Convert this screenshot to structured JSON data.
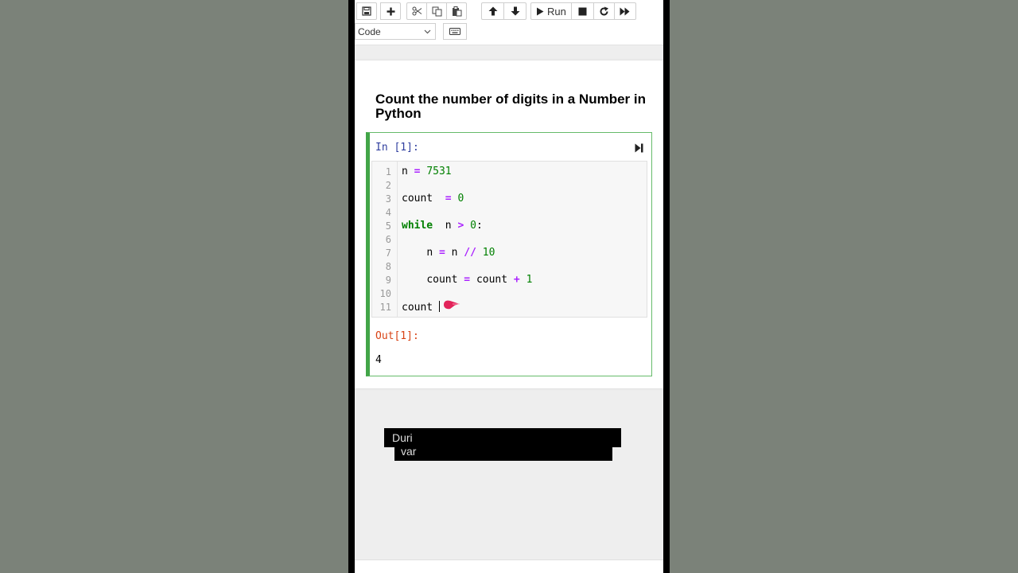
{
  "toolbar": {
    "buttons": [
      {
        "icon": "save-icon"
      },
      {
        "icon": "plus-icon"
      },
      {
        "icon": "cut-icon"
      },
      {
        "icon": "copy-icon"
      },
      {
        "icon": "paste-icon"
      },
      {
        "icon": "arrow-up-icon"
      },
      {
        "icon": "arrow-down-icon"
      },
      {
        "icon": "run-icon"
      },
      {
        "icon": "stop-icon"
      },
      {
        "icon": "restart-icon"
      },
      {
        "icon": "fast-forward-icon"
      }
    ],
    "run_label": "Run",
    "cell_type": "Code",
    "keyboard_icon": "keyboard-icon"
  },
  "notebook": {
    "title": "Count the number of digits in a Number in Python",
    "cell": {
      "in_prompt": "In [1]:",
      "out_prompt": "Out[1]:",
      "output": "4",
      "line_numbers": [
        "1",
        "2",
        "3",
        "4",
        "5",
        "6",
        "7",
        "8",
        "9",
        "10",
        "11"
      ],
      "code_lines": [
        "n = 7531",
        "",
        "count  = 0",
        "",
        "while  n > 0:",
        "",
        "    n = n // 10",
        "",
        "    count = count + 1",
        "",
        "count "
      ]
    }
  },
  "captions": {
    "line1": "Duri",
    "line2": "var"
  },
  "colors": {
    "cell_border": "#42a548",
    "in_prompt": "#303f9f",
    "out_prompt": "#d84315",
    "keyword": "#008000",
    "operator": "#aa22ff",
    "number": "#008000"
  }
}
